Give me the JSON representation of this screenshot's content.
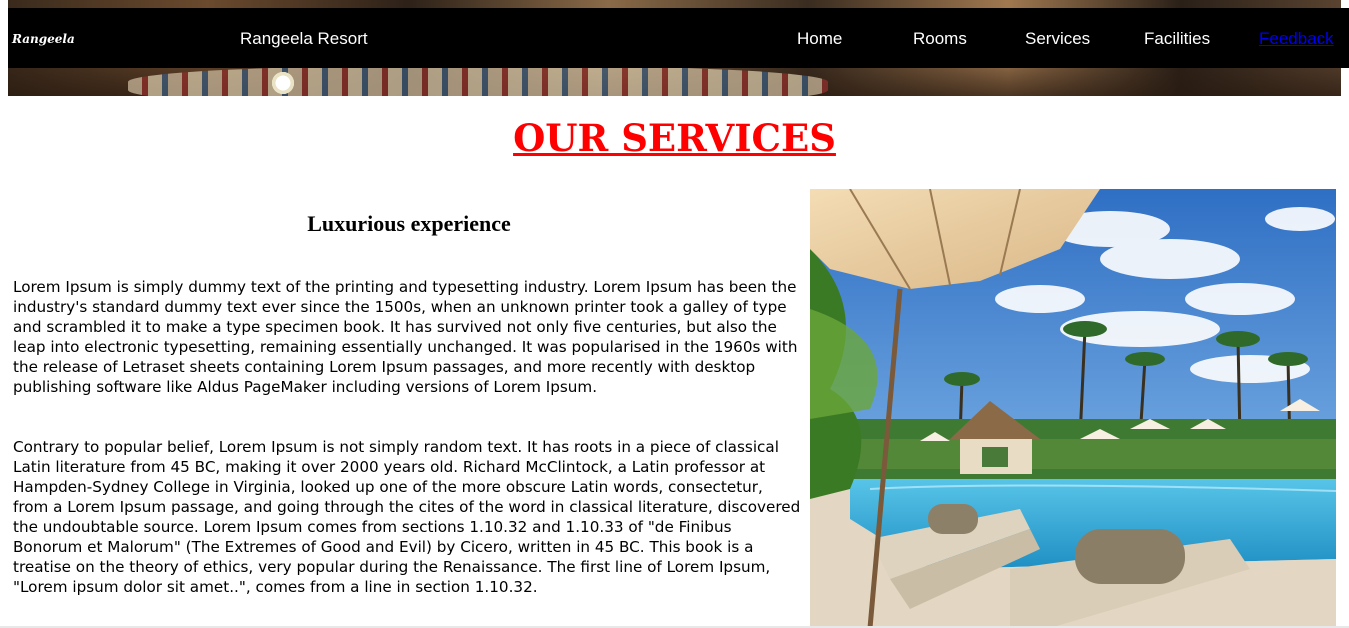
{
  "nav": {
    "logo_text": "Rangeela",
    "brand": "Rangeela Resort",
    "links": [
      {
        "label": "Home"
      },
      {
        "label": "Rooms"
      },
      {
        "label": "Services"
      },
      {
        "label": "Facilities"
      },
      {
        "label": "Feedback"
      }
    ]
  },
  "page_title": "OUR SERVICES",
  "section": {
    "heading": "Luxurious experience",
    "paragraphs": [
      "Lorem Ipsum is simply dummy text of the printing and typesetting industry. Lorem Ipsum has been the industry's standard dummy text ever since the 1500s, when an unknown printer took a galley of type and scrambled it to make a type specimen book. It has survived not only five centuries, but also the leap into electronic typesetting, remaining essentially unchanged. It was popularised in the 1960s with the release of Letraset sheets containing Lorem Ipsum passages, and more recently with desktop publishing software like Aldus PageMaker including versions of Lorem Ipsum.",
      "Contrary to popular belief, Lorem Ipsum is not simply random text. It has roots in a piece of classical Latin literature from 45 BC, making it over 2000 years old. Richard McClintock, a Latin professor at Hampden-Sydney College in Virginia, looked up one of the more obscure Latin words, consectetur, from a Lorem Ipsum passage, and going through the cites of the word in classical literature, discovered the undoubtable source. Lorem Ipsum comes from sections 1.10.32 and 1.10.33 of \"de Finibus Bonorum et Malorum\" (The Extremes of Good and Evil) by Cicero, written in 45 BC. This book is a treatise on the theory of ethics, very popular during the Renaissance. The first line of Lorem Ipsum, \"Lorem ipsum dolor sit amet..\", comes from a line in section 1.10.32."
    ]
  },
  "colors": {
    "nav_bg": "#000000",
    "title_red": "#ff0000",
    "link_blue": "#0000ee"
  }
}
